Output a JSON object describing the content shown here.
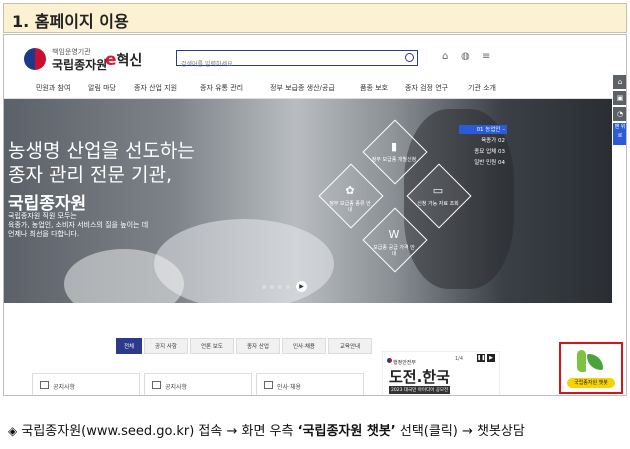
{
  "step_title": "1. 홈페이지 이용",
  "header": {
    "logo_sub": "책임운영기관",
    "logo_main": "국립종자원",
    "brand_e": "e",
    "brand_rest": "혁신",
    "search_placeholder": "검색어를 입력하세요"
  },
  "nav": [
    "민원과 참여",
    "알림 마당",
    "종자 산업 지원",
    "종자 유통 관리",
    "정부 보급종 생산/공급",
    "품종 보호",
    "종자 검정 연구",
    "기관 소개"
  ],
  "hero": {
    "line1": "농생명 산업을 선도하는",
    "line2": "종자 관리 전문 기관,",
    "line3": "국립종자원",
    "desc1": "국립종자원 직원 모두는",
    "desc2": "육종가, 농업인, 소비자 서비스의 질을 높이는 데",
    "desc3": "언제나 최선을 다합니다.",
    "hexes": [
      {
        "label": "정부 보급종 개별신청",
        "glyph": "▮"
      },
      {
        "label": "정부 보급종 종류 안내",
        "glyph": "✿"
      },
      {
        "label": "신청 가능 자료 조회",
        "glyph": "▭"
      },
      {
        "label": "보급종 공급 가격 안내",
        "glyph": "W"
      }
    ],
    "quick_list": [
      "01 농업인 –",
      "육종가 02",
      "종묘 업체 03",
      "일반 민원 04"
    ]
  },
  "quick_bar": [
    "⌂",
    "▣",
    "◔",
    "맨 위로"
  ],
  "tabs": [
    "전체",
    "공지 사항",
    "언론 보도",
    "종자 산업",
    "인사·채용",
    "교육안내"
  ],
  "cards": [
    "공지사항",
    "공지사항",
    "인사·채용"
  ],
  "banner": {
    "page": "1/4",
    "org": "행정안전부",
    "title": "도전.한국",
    "subtitle": "2023 대국민 아이디어 공모전"
  },
  "chatbot_label": "국립종자원 챗봇",
  "caption": {
    "bullet": "◈",
    "pre": "국립종자원(www.seed.go.kr) 접속 → 화면 우측 ",
    "bold": "‘국립종자원 챗봇’",
    "post": " 선택(클릭) → 챗봇상담"
  }
}
